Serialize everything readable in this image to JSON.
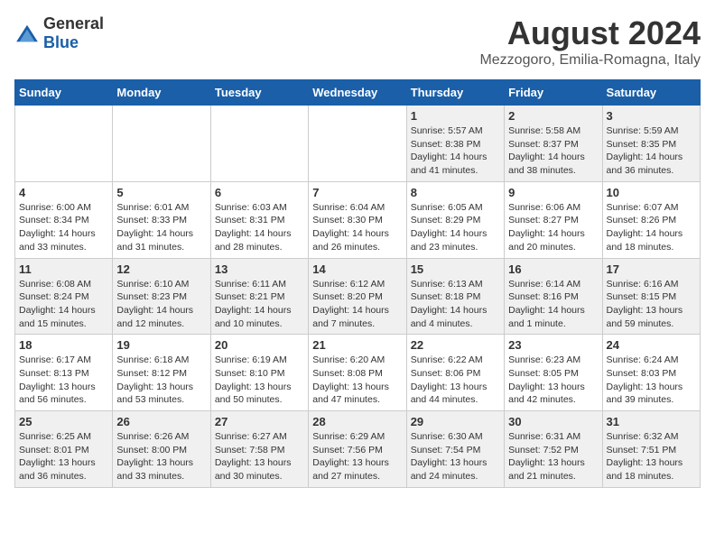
{
  "header": {
    "logo_general": "General",
    "logo_blue": "Blue",
    "month_year": "August 2024",
    "location": "Mezzogoro, Emilia-Romagna, Italy"
  },
  "weekdays": [
    "Sunday",
    "Monday",
    "Tuesday",
    "Wednesday",
    "Thursday",
    "Friday",
    "Saturday"
  ],
  "weeks": [
    [
      {
        "day": "",
        "info": ""
      },
      {
        "day": "",
        "info": ""
      },
      {
        "day": "",
        "info": ""
      },
      {
        "day": "",
        "info": ""
      },
      {
        "day": "1",
        "info": "Sunrise: 5:57 AM\nSunset: 8:38 PM\nDaylight: 14 hours\nand 41 minutes."
      },
      {
        "day": "2",
        "info": "Sunrise: 5:58 AM\nSunset: 8:37 PM\nDaylight: 14 hours\nand 38 minutes."
      },
      {
        "day": "3",
        "info": "Sunrise: 5:59 AM\nSunset: 8:35 PM\nDaylight: 14 hours\nand 36 minutes."
      }
    ],
    [
      {
        "day": "4",
        "info": "Sunrise: 6:00 AM\nSunset: 8:34 PM\nDaylight: 14 hours\nand 33 minutes."
      },
      {
        "day": "5",
        "info": "Sunrise: 6:01 AM\nSunset: 8:33 PM\nDaylight: 14 hours\nand 31 minutes."
      },
      {
        "day": "6",
        "info": "Sunrise: 6:03 AM\nSunset: 8:31 PM\nDaylight: 14 hours\nand 28 minutes."
      },
      {
        "day": "7",
        "info": "Sunrise: 6:04 AM\nSunset: 8:30 PM\nDaylight: 14 hours\nand 26 minutes."
      },
      {
        "day": "8",
        "info": "Sunrise: 6:05 AM\nSunset: 8:29 PM\nDaylight: 14 hours\nand 23 minutes."
      },
      {
        "day": "9",
        "info": "Sunrise: 6:06 AM\nSunset: 8:27 PM\nDaylight: 14 hours\nand 20 minutes."
      },
      {
        "day": "10",
        "info": "Sunrise: 6:07 AM\nSunset: 8:26 PM\nDaylight: 14 hours\nand 18 minutes."
      }
    ],
    [
      {
        "day": "11",
        "info": "Sunrise: 6:08 AM\nSunset: 8:24 PM\nDaylight: 14 hours\nand 15 minutes."
      },
      {
        "day": "12",
        "info": "Sunrise: 6:10 AM\nSunset: 8:23 PM\nDaylight: 14 hours\nand 12 minutes."
      },
      {
        "day": "13",
        "info": "Sunrise: 6:11 AM\nSunset: 8:21 PM\nDaylight: 14 hours\nand 10 minutes."
      },
      {
        "day": "14",
        "info": "Sunrise: 6:12 AM\nSunset: 8:20 PM\nDaylight: 14 hours\nand 7 minutes."
      },
      {
        "day": "15",
        "info": "Sunrise: 6:13 AM\nSunset: 8:18 PM\nDaylight: 14 hours\nand 4 minutes."
      },
      {
        "day": "16",
        "info": "Sunrise: 6:14 AM\nSunset: 8:16 PM\nDaylight: 14 hours\nand 1 minute."
      },
      {
        "day": "17",
        "info": "Sunrise: 6:16 AM\nSunset: 8:15 PM\nDaylight: 13 hours\nand 59 minutes."
      }
    ],
    [
      {
        "day": "18",
        "info": "Sunrise: 6:17 AM\nSunset: 8:13 PM\nDaylight: 13 hours\nand 56 minutes."
      },
      {
        "day": "19",
        "info": "Sunrise: 6:18 AM\nSunset: 8:12 PM\nDaylight: 13 hours\nand 53 minutes."
      },
      {
        "day": "20",
        "info": "Sunrise: 6:19 AM\nSunset: 8:10 PM\nDaylight: 13 hours\nand 50 minutes."
      },
      {
        "day": "21",
        "info": "Sunrise: 6:20 AM\nSunset: 8:08 PM\nDaylight: 13 hours\nand 47 minutes."
      },
      {
        "day": "22",
        "info": "Sunrise: 6:22 AM\nSunset: 8:06 PM\nDaylight: 13 hours\nand 44 minutes."
      },
      {
        "day": "23",
        "info": "Sunrise: 6:23 AM\nSunset: 8:05 PM\nDaylight: 13 hours\nand 42 minutes."
      },
      {
        "day": "24",
        "info": "Sunrise: 6:24 AM\nSunset: 8:03 PM\nDaylight: 13 hours\nand 39 minutes."
      }
    ],
    [
      {
        "day": "25",
        "info": "Sunrise: 6:25 AM\nSunset: 8:01 PM\nDaylight: 13 hours\nand 36 minutes."
      },
      {
        "day": "26",
        "info": "Sunrise: 6:26 AM\nSunset: 8:00 PM\nDaylight: 13 hours\nand 33 minutes."
      },
      {
        "day": "27",
        "info": "Sunrise: 6:27 AM\nSunset: 7:58 PM\nDaylight: 13 hours\nand 30 minutes."
      },
      {
        "day": "28",
        "info": "Sunrise: 6:29 AM\nSunset: 7:56 PM\nDaylight: 13 hours\nand 27 minutes."
      },
      {
        "day": "29",
        "info": "Sunrise: 6:30 AM\nSunset: 7:54 PM\nDaylight: 13 hours\nand 24 minutes."
      },
      {
        "day": "30",
        "info": "Sunrise: 6:31 AM\nSunset: 7:52 PM\nDaylight: 13 hours\nand 21 minutes."
      },
      {
        "day": "31",
        "info": "Sunrise: 6:32 AM\nSunset: 7:51 PM\nDaylight: 13 hours\nand 18 minutes."
      }
    ]
  ]
}
